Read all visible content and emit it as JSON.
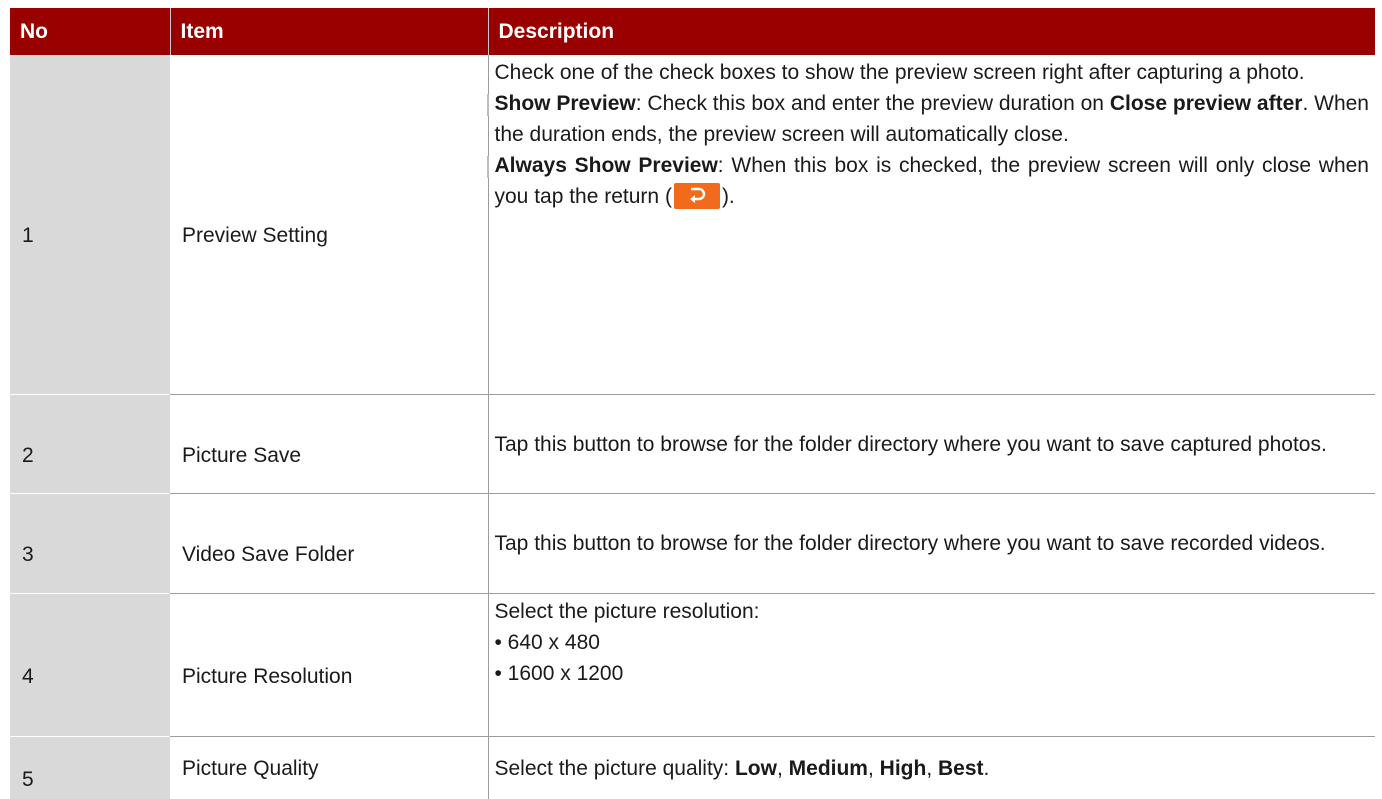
{
  "header": {
    "no": "No",
    "item": "Item",
    "description": "Description"
  },
  "rows": [
    {
      "no": "1",
      "item": "Preview Setting",
      "desc": {
        "intro": "Check one of the check boxes to show the preview screen right after capturing a photo.",
        "show_preview_label": "Show Preview",
        "show_preview_text_a": ": Check this box and enter the preview duration on ",
        "close_preview_label": "Close preview after",
        "show_preview_text_b": ". When the duration ends, the preview screen will automatically close.",
        "always_label": "Always Show Preview",
        "always_text_a": ": When this box is checked, the preview screen will only close when you tap the return (",
        "always_text_b": ")."
      }
    },
    {
      "no": "2",
      "item": "Picture Save",
      "desc": "Tap this button to browse for the folder directory where you want to save captured photos."
    },
    {
      "no": "3",
      "item": "Video Save Folder",
      "desc": "Tap this button to browse for the folder directory where you want to save recorded videos."
    },
    {
      "no": "4",
      "item": "Picture Resolution",
      "desc": {
        "intro": "Select the picture resolution:",
        "options": [
          "• 640 x 480",
          "• 1600 x 1200"
        ]
      }
    },
    {
      "no": "5",
      "item": "Picture Quality",
      "desc": {
        "intro": "Select the picture quality: ",
        "low": "Low",
        "sep1": ", ",
        "medium": "Medium",
        "sep2": ", ",
        "high": "High",
        "sep3": ", ",
        "best": "Best",
        "end": "."
      }
    }
  ],
  "icons": {
    "return": "return-arrow-icon",
    "return_color": "#f26a1b"
  },
  "colors": {
    "header_bg": "#990000",
    "no_column_bg": "#d9d9d9"
  }
}
